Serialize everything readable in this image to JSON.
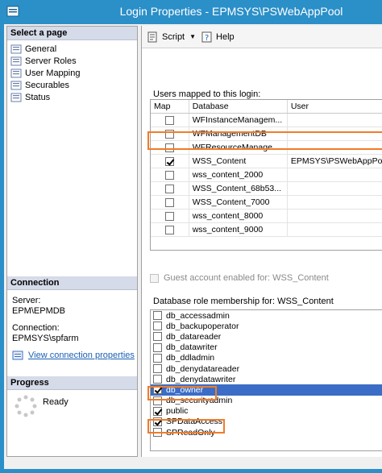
{
  "window": {
    "title": "Login Properties - EPMSYS\\PSWebAppPool"
  },
  "sidebar": {
    "select_header": "Select a page",
    "pages": [
      {
        "label": "General"
      },
      {
        "label": "Server Roles"
      },
      {
        "label": "User Mapping"
      },
      {
        "label": "Securables"
      },
      {
        "label": "Status"
      }
    ],
    "connection_header": "Connection",
    "server_label": "Server:",
    "server_value": "EPM\\EPMDB",
    "connection_label": "Connection:",
    "connection_value": "EPMSYS\\spfarm",
    "view_link": "View connection properties",
    "progress_header": "Progress",
    "progress_status": "Ready"
  },
  "toolbar": {
    "script_label": "Script",
    "help_label": "Help"
  },
  "mapping": {
    "label": "Users mapped to this login:",
    "columns": [
      "Map",
      "Database",
      "User"
    ],
    "rows": [
      {
        "map": false,
        "database": "WFInstanceManagem...",
        "user": ""
      },
      {
        "map": false,
        "database": "WFManagementDB",
        "user": ""
      },
      {
        "map": false,
        "database": "WFResourceManage...",
        "user": ""
      },
      {
        "map": true,
        "database": "WSS_Content",
        "user": "EPMSYS\\PSWebAppPool"
      },
      {
        "map": false,
        "database": "wss_content_2000",
        "user": ""
      },
      {
        "map": false,
        "database": "WSS_Content_68b53...",
        "user": ""
      },
      {
        "map": false,
        "database": "WSS_Content_7000",
        "user": ""
      },
      {
        "map": false,
        "database": "wss_content_8000",
        "user": ""
      },
      {
        "map": false,
        "database": "wss_content_9000",
        "user": ""
      }
    ]
  },
  "guest": {
    "label": "Guest account enabled for: WSS_Content",
    "checked": false
  },
  "roles": {
    "label": "Database role membership for: WSS_Content",
    "items": [
      {
        "label": "db_accessadmin",
        "checked": false
      },
      {
        "label": "db_backupoperator",
        "checked": false
      },
      {
        "label": "db_datareader",
        "checked": false
      },
      {
        "label": "db_datawriter",
        "checked": false
      },
      {
        "label": "db_ddladmin",
        "checked": false
      },
      {
        "label": "db_denydatareader",
        "checked": false
      },
      {
        "label": "db_denydatawriter",
        "checked": false
      },
      {
        "label": "db_owner",
        "checked": true,
        "selected": true
      },
      {
        "label": "db_securityadmin",
        "checked": false
      },
      {
        "label": "public",
        "checked": true
      },
      {
        "label": "SPDataAccess",
        "checked": true
      },
      {
        "label": "SPReadOnly",
        "checked": false
      }
    ]
  },
  "colors": {
    "accent": "#2b8fc8",
    "highlight": "#f07c2a",
    "selection": "#3b6dc6"
  }
}
